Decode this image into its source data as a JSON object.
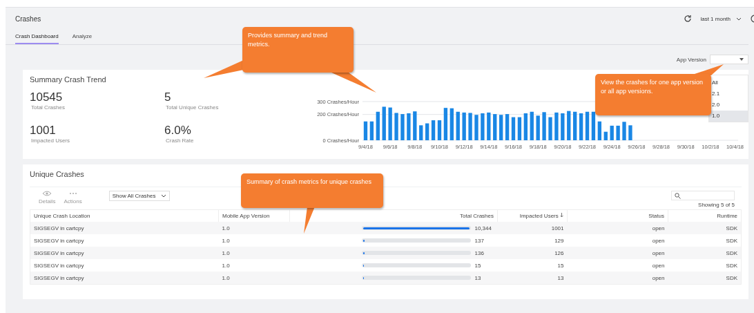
{
  "page": {
    "title": "Crashes",
    "time_range": "last 1 month"
  },
  "tabs": [
    {
      "label": "Crash Dashboard",
      "selected": true
    },
    {
      "label": "Analyze",
      "selected": false
    }
  ],
  "app_version": {
    "label": "App Version",
    "options": [
      {
        "label": "All",
        "selected": false
      },
      {
        "label": "2.1",
        "selected": false
      },
      {
        "label": "2.0",
        "selected": false
      },
      {
        "label": "1.0",
        "selected": true
      }
    ]
  },
  "summary": {
    "title": "Summary Crash Trend",
    "metrics": [
      {
        "value": "10545",
        "label": "Total Crashes"
      },
      {
        "value": "5",
        "label": "Total Unique Crashes"
      },
      {
        "value": "1001",
        "label": "Impacted Users"
      },
      {
        "value": "6.0%",
        "label": "Crash Rate"
      }
    ],
    "chart_data": {
      "type": "bar",
      "categories": [
        "9/4/18",
        null,
        null,
        null,
        "9/6/18",
        null,
        null,
        null,
        "9/8/18",
        null,
        null,
        null,
        "9/10/18",
        null,
        null,
        null,
        "9/12/18",
        null,
        null,
        null,
        "9/14/18",
        null,
        null,
        null,
        "9/16/18",
        null,
        null,
        null,
        "9/18/18",
        null,
        null,
        null,
        "9/20/18",
        null,
        null,
        null,
        "9/22/18",
        null,
        null,
        null,
        "9/24/18",
        null,
        null,
        null,
        "9/26/18",
        null,
        null,
        null,
        "9/28/18",
        null,
        null,
        null,
        "9/30/18",
        null,
        null,
        null,
        "10/2/18",
        null,
        null,
        null,
        "10/4/18"
      ],
      "series": [
        {
          "color": "#1a87e5",
          "values": [
            146,
            146,
            221,
            260,
            254,
            212,
            203,
            209,
            224,
            116,
            131,
            155,
            155,
            251,
            248,
            221,
            215,
            212,
            197,
            209,
            215,
            203,
            197,
            203,
            179,
            179,
            209,
            221,
            191,
            218,
            179,
            215,
            209,
            227,
            221,
            209,
            221,
            221,
            146,
            66,
            113,
            113,
            143,
            116,
            null,
            null,
            null,
            null,
            null,
            null,
            null,
            null,
            null,
            null,
            null,
            null,
            null,
            null,
            null,
            null,
            null
          ]
        }
      ],
      "ylim": [
        0,
        300
      ],
      "yticks": [
        {
          "value": 0,
          "label": "0 Crashes/Hour"
        },
        {
          "value": 200,
          "label": "200 Crashes/Hour"
        },
        {
          "value": 300,
          "label": "300 Crashes/Hour"
        }
      ]
    }
  },
  "unique": {
    "title": "Unique Crashes",
    "toolbar": [
      {
        "label": "Details",
        "kind": "eye"
      },
      {
        "label": "Actions",
        "kind": "more"
      }
    ],
    "filter": "Show All Crashes",
    "showing": "Showing 5 of 5",
    "columns": [
      "Unique Crash Location",
      "Mobile App Version",
      "Total Crashes",
      "Impacted Users",
      "Status",
      "Runtime"
    ],
    "rows": [
      {
        "location": "SIGSEGV in cartcpy",
        "version": "1.0",
        "level": 1,
        "total": "10,344",
        "users": "1001",
        "status": "open",
        "runtime": "SDK"
      },
      {
        "location": "SIGSEGV in cartcpy",
        "version": "1.0",
        "level": 0.013,
        "total": "137",
        "users": "129",
        "status": "open",
        "runtime": "SDK"
      },
      {
        "location": "SIGSEGV in cartcpy",
        "version": "1.0",
        "level": 0.013,
        "total": "136",
        "users": "126",
        "status": "open",
        "runtime": "SDK"
      },
      {
        "location": "SIGSEGV in cartcpy",
        "version": "1.0",
        "level": 0.0015,
        "total": "15",
        "users": "15",
        "status": "open",
        "runtime": "SDK"
      },
      {
        "location": "SIGSEGV in cartcpy",
        "version": "1.0",
        "level": 0.0013,
        "total": "13",
        "users": "13",
        "status": "open",
        "runtime": "SDK"
      }
    ]
  },
  "callouts": [
    {
      "text": "Provides summary and trend metrics.",
      "kind": "summary"
    },
    {
      "text": "View the crashes for one app version or all app versions.",
      "kind": "version"
    },
    {
      "text": "Summary of crash metrics for unique crashes",
      "kind": "table"
    }
  ]
}
